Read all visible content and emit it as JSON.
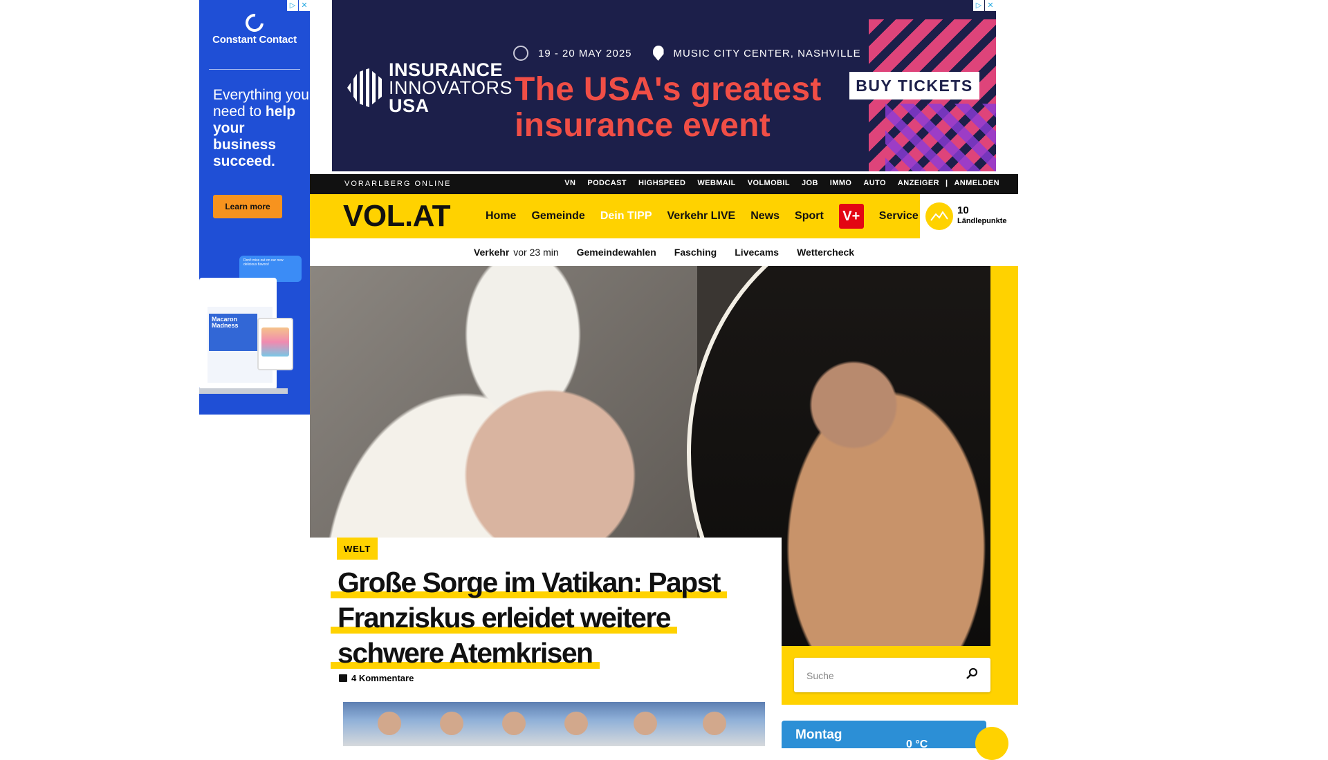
{
  "ad_left": {
    "brand": "Constant Contact",
    "tagline_plain": "Everything you need to ",
    "tagline_bold": "help your business succeed.",
    "cta": "Learn more",
    "mock_title": "Macaron Madness",
    "bubble_text": "Don't miss out on our new delicious flavors!",
    "accent": "#1f4fd6",
    "cta_color": "#f7931e"
  },
  "ad_top": {
    "brand_line1": "INSURANCE",
    "brand_line2": "INNOVATORS",
    "brand_line3": "USA",
    "date": "19 - 20 MAY 2025",
    "venue": "MUSIC CITY CENTER, NASHVILLE",
    "headline_line1": "The USA's greatest",
    "headline_line2": "insurance event",
    "cta": "BUY TICKETS",
    "bg": "#1c1f4a",
    "headline_color": "#f04e46"
  },
  "topbar": {
    "site_name": "VORARLBERG ONLINE",
    "links": [
      "VN",
      "PODCAST",
      "HIGHSPEED",
      "WEBMAIL",
      "VOLMOBIL",
      "JOB",
      "IMMO",
      "AUTO",
      "ANZEIGER"
    ],
    "login": "ANMELDEN"
  },
  "navbar": {
    "logo": "VOL.AT",
    "items": [
      "Home",
      "Gemeinde",
      "Dein TIPP",
      "Verkehr LIVE",
      "News",
      "Sport"
    ],
    "vplus": "V+",
    "service": "Service",
    "points_value": "10",
    "points_label": "Ländlepunkte",
    "accent": "#ffd200"
  },
  "subnav": {
    "traffic_label": "Verkehr",
    "traffic_time": "vor 23 min",
    "items": [
      "Gemeindewahlen",
      "Fasching",
      "Livecams",
      "Wettercheck"
    ]
  },
  "article": {
    "category": "WELT",
    "title": "Große Sorge im Vatikan: Papst Franziskus erleidet weitere schwere Atemkrisen",
    "comments": "4 Kommentare"
  },
  "sidebar": {
    "search_placeholder": "Suche",
    "weather_day": "Montag",
    "weather_temp": "0 °C"
  }
}
